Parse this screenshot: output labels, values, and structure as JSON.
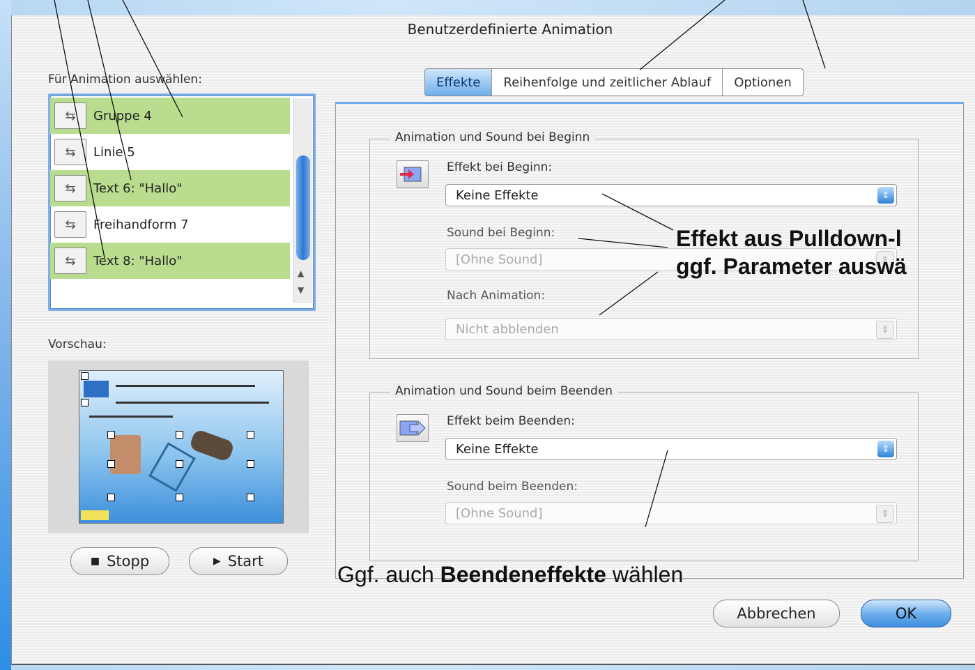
{
  "dialog": {
    "title": "Benutzerdefinierte Animation"
  },
  "left": {
    "select_label": "Für Animation auswählen:",
    "items": [
      {
        "label": "Gruppe 4",
        "icon": "animation-object-icon"
      },
      {
        "label": "Linie 5",
        "icon": "animation-object-icon"
      },
      {
        "label": "Text 6: \"Hallo\"",
        "icon": "animation-object-icon"
      },
      {
        "label": "Freihandform 7",
        "icon": "animation-object-icon"
      },
      {
        "label": "Text 8: \"Hallo\"",
        "icon": "animation-object-icon"
      }
    ],
    "preview_label": "Vorschau:",
    "stop_label": "Stopp",
    "start_label": "Start"
  },
  "tabs": [
    {
      "label": "Effekte",
      "active": true
    },
    {
      "label": "Reihenfolge und zeitlicher Ablauf",
      "active": false
    },
    {
      "label": "Optionen",
      "active": false
    }
  ],
  "begin_group": {
    "title": "Animation und Sound bei Beginn",
    "effect_label": "Effekt bei Beginn:",
    "effect_value": "Keine Effekte",
    "sound_label": "Sound bei Beginn:",
    "sound_value": "[Ohne Sound]",
    "after_label": "Nach Animation:",
    "after_value": "Nicht abblenden"
  },
  "end_group": {
    "title": "Animation und Sound beim Beenden",
    "effect_label": "Effekt beim Beenden:",
    "effect_value": "Keine Effekte",
    "sound_label": "Sound beim Beenden:",
    "sound_value": "[Ohne Sound]"
  },
  "buttons": {
    "cancel": "Abbrechen",
    "ok": "OK"
  },
  "annotations": {
    "pulldown_line1": "Effekt aus Pulldown-l",
    "pulldown_line2": "ggf. Parameter auswä",
    "end_prefix": "Ggf. auch ",
    "end_bold": "Beendeneffekte",
    "end_suffix": " wählen"
  },
  "colors": {
    "accent": "#3d8ee0",
    "list_highlight": "#b9dc8f"
  }
}
